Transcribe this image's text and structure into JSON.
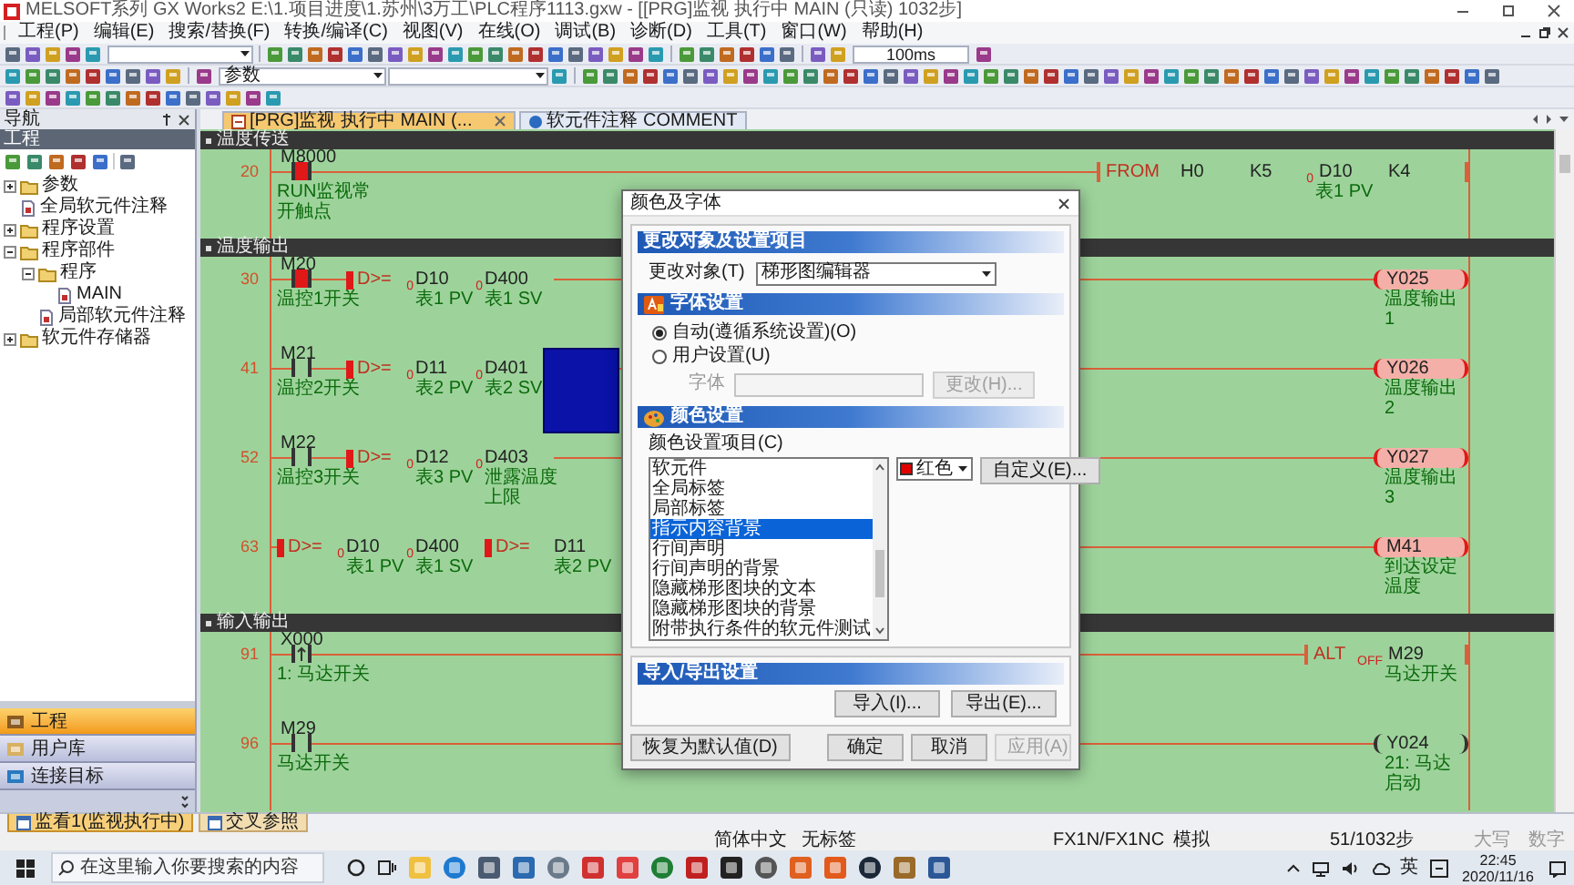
{
  "window": {
    "title": "MELSOFT系列 GX Works2 E:\\1.项目进度\\1.苏州\\3万工\\PLC程序1113.gxw - [[PRG]监视 执行中 MAIN (只读) 1032步]"
  },
  "menu": [
    "工程(P)",
    "编辑(E)",
    "搜索/替换(F)",
    "转换/编译(C)",
    "视图(V)",
    "在线(O)",
    "调试(B)",
    "诊断(D)",
    "工具(T)",
    "窗口(W)",
    "帮助(H)"
  ],
  "toolbar": {
    "scan_time": "100ms",
    "parameter_select": "参数"
  },
  "navigation": {
    "title": "导航",
    "pane_title": "工程",
    "tree": [
      {
        "label": "参数",
        "expanded": false
      },
      {
        "label": "全局软元件注释"
      },
      {
        "label": "程序设置",
        "expanded": false
      },
      {
        "label": "程序部件",
        "expanded": true,
        "children": [
          {
            "label": "程序",
            "expanded": true,
            "children": [
              {
                "label": "MAIN"
              }
            ]
          },
          {
            "label": "局部软元件注释"
          }
        ]
      },
      {
        "label": "软元件存储器",
        "expanded": false
      }
    ],
    "bottom_buttons": [
      {
        "label": "工程",
        "selected": true
      },
      {
        "label": "用户库",
        "selected": false
      },
      {
        "label": "连接目标",
        "selected": false
      }
    ]
  },
  "document_tabs": [
    {
      "label": "[PRG]监视 执行中 MAIN (...",
      "selected": true
    },
    {
      "label": "软元件注释 COMMENT",
      "selected": false
    }
  ],
  "ladder": {
    "blocks": [
      {
        "kind": "section",
        "title": "温度传送"
      },
      {
        "kind": "rung",
        "step": "20",
        "cells": [
          {
            "kind": "contact",
            "device": "M8000",
            "comment": "RUN监视常开触点",
            "on": true
          }
        ],
        "output": {
          "kind": "function",
          "name": "FROM",
          "args": [
            {
              "device": "H0"
            },
            {
              "device": "K5"
            },
            {
              "device": "D10",
              "comment": "表1 PV",
              "value": "0"
            },
            {
              "device": "K4"
            }
          ]
        }
      },
      {
        "kind": "section",
        "title": "温度输出"
      },
      {
        "kind": "rung",
        "step": "30",
        "cells": [
          {
            "kind": "contact",
            "device": "M20",
            "comment": "温控1开关",
            "on": true
          },
          {
            "kind": "compare",
            "operator": "D>=",
            "on": true
          },
          {
            "kind": "operand",
            "device": "D10",
            "comment": "表1 PV",
            "value": "0"
          },
          {
            "kind": "operand",
            "device": "D400",
            "comment": "表1 SV",
            "value": "0"
          }
        ],
        "output": {
          "kind": "coil",
          "device": "Y025",
          "comment": "温度输出1",
          "on": true
        }
      },
      {
        "kind": "rung",
        "step": "41",
        "cells": [
          {
            "kind": "contact",
            "device": "M21",
            "comment": "温控2开关",
            "on": false
          },
          {
            "kind": "compare",
            "operator": "D>=",
            "on": true
          },
          {
            "kind": "operand",
            "device": "D11",
            "comment": "表2 PV",
            "value": "0"
          },
          {
            "kind": "operand",
            "device": "D401",
            "comment": "表2 SV",
            "value": "0"
          },
          {
            "kind": "cursor"
          }
        ],
        "output": {
          "kind": "coil",
          "device": "Y026",
          "comment": "温度输出2",
          "on": true
        }
      },
      {
        "kind": "rung",
        "step": "52",
        "cells": [
          {
            "kind": "contact",
            "device": "M22",
            "comment": "温控3开关",
            "on": false
          },
          {
            "kind": "compare",
            "operator": "D>=",
            "on": true
          },
          {
            "kind": "operand",
            "device": "D12",
            "comment": "表3 PV",
            "value": "0"
          },
          {
            "kind": "operand",
            "device": "D403",
            "comment": "泄露温度上限",
            "value": "0"
          }
        ],
        "output": {
          "kind": "coil",
          "device": "Y027",
          "comment": "温度输出3",
          "on": true
        }
      },
      {
        "kind": "rung",
        "step": "63",
        "cells": [
          {
            "kind": "compare",
            "operator": "D>=",
            "on": true
          },
          {
            "kind": "operand",
            "device": "D10",
            "comment": "表1 PV",
            "value": "0"
          },
          {
            "kind": "operand",
            "device": "D400",
            "comment": "表1 SV",
            "value": "0"
          },
          {
            "kind": "compare",
            "operator": "D>=",
            "on": true
          },
          {
            "kind": "operand",
            "device": "D11",
            "comment": "表2 PV"
          }
        ],
        "output": {
          "kind": "coil",
          "device": "M41",
          "comment": "到达设定温度",
          "on": true
        }
      },
      {
        "kind": "section",
        "title": "输入输出"
      },
      {
        "kind": "rung",
        "step": "91",
        "cells": [
          {
            "kind": "pulse_contact",
            "device": "X000",
            "comment": "1: 马达开关",
            "on": false
          }
        ],
        "output": {
          "kind": "function",
          "name": "ALT",
          "args": [
            {
              "device": "M29",
              "comment": "马达开关",
              "value": "OFF"
            }
          ]
        }
      },
      {
        "kind": "rung",
        "step": "96",
        "cells": [
          {
            "kind": "contact",
            "device": "M29",
            "comment": "马达开关",
            "on": false
          }
        ],
        "output": {
          "kind": "coil",
          "device": "Y024",
          "comment": "21: 马达启动",
          "on": false
        }
      }
    ]
  },
  "bottom_tabs": [
    {
      "label": "监看1(监视执行中)",
      "selected": true
    },
    {
      "label": "交叉参照",
      "selected": false
    }
  ],
  "status_bar": [
    "简体中文",
    "无标签",
    "FX1N/FX1NC",
    "模拟",
    "51/1032步",
    "大写",
    "数字"
  ],
  "dialog": {
    "title": "颜色及字体",
    "target_section": "更改对象及设置项目",
    "target_label": "更改对象(T)",
    "target_value": "梯形图编辑器",
    "font_section": "字体设置",
    "font_options": [
      {
        "label": "自动(遵循系统设置)(O)",
        "selected": true
      },
      {
        "label": "用户设置(U)",
        "selected": false
      }
    ],
    "font_label": "字体",
    "font_change_button": {
      "label": "更改(H)...",
      "disabled": true
    },
    "color_section": "颜色设置",
    "color_items_label": "颜色设置项目(C)",
    "color_items": [
      {
        "label": "软元件",
        "selected": false
      },
      {
        "label": "全局标签",
        "selected": false
      },
      {
        "label": "局部标签",
        "selected": false
      },
      {
        "label": "指示内容背景",
        "selected": true
      },
      {
        "label": "行间声明",
        "selected": false
      },
      {
        "label": "行间声明的背景",
        "selected": false
      },
      {
        "label": "隐藏梯形图块的文本",
        "selected": false
      },
      {
        "label": "隐藏梯形图块的背景",
        "selected": false
      },
      {
        "label": "附带执行条件的软元件测试",
        "selected": false
      }
    ],
    "color_value": "红色",
    "custom_button": "自定义(E)...",
    "import_section": "导入/导出设置",
    "import_button": "导入(I)...",
    "export_button": "导出(E)...",
    "reset_button": "恢复为默认值(D)",
    "ok_button": "确定",
    "cancel_button": "取消",
    "apply_button": {
      "label": "应用(A)",
      "disabled": true
    }
  },
  "taskbar": {
    "search_placeholder": "在这里输入你要搜索的内容",
    "ime": "英",
    "time": "22:45",
    "date": "2020/11/16"
  }
}
